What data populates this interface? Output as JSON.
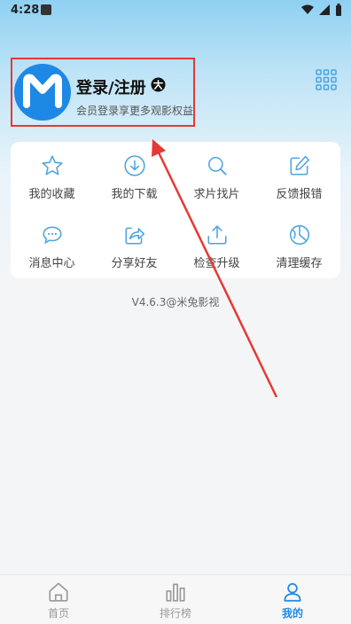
{
  "status_bar": {
    "time": "4:28"
  },
  "profile": {
    "title": "登录/注册",
    "subtitle": "会员登录享更多观影权益"
  },
  "menu": [
    {
      "label": "我的收藏",
      "icon": "star-icon"
    },
    {
      "label": "我的下载",
      "icon": "download-icon"
    },
    {
      "label": "求片找片",
      "icon": "search-icon"
    },
    {
      "label": "反馈报错",
      "icon": "edit-icon"
    },
    {
      "label": "消息中心",
      "icon": "message-icon"
    },
    {
      "label": "分享好友",
      "icon": "share-icon"
    },
    {
      "label": "检查升级",
      "icon": "upload-icon"
    },
    {
      "label": "清理缓存",
      "icon": "clean-icon"
    }
  ],
  "version": "V4.6.3@米兔影视",
  "bottom_nav": [
    {
      "label": "首页",
      "icon": "home-icon"
    },
    {
      "label": "排行榜",
      "icon": "chart-icon"
    },
    {
      "label": "我的",
      "icon": "user-icon",
      "active": true
    }
  ],
  "colors": {
    "accent": "#1e88e5",
    "highlight_border": "#e53935",
    "icon": "#4aa3df"
  }
}
